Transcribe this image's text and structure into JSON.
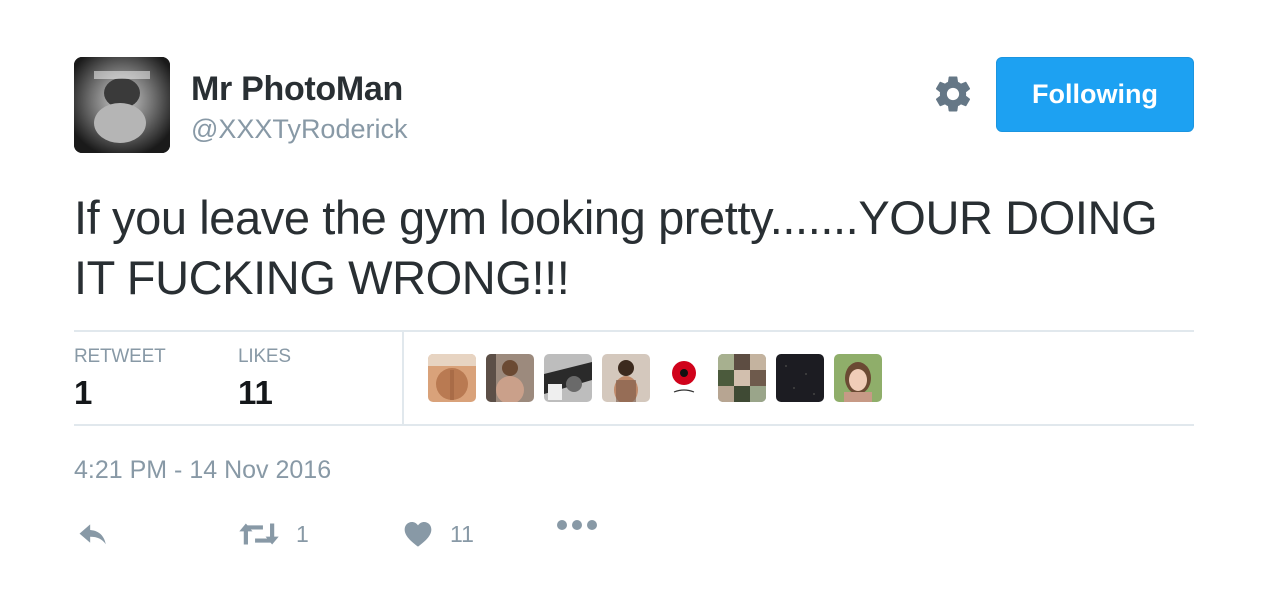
{
  "user": {
    "name": "Mr PhotoMan",
    "handle": "@XXXTyRoderick",
    "follow_button": "Following",
    "settings_icon": "gear-icon"
  },
  "tweet": {
    "text": "If you leave the gym looking pretty.......YOUR DOING IT FUCKING WRONG!!!",
    "timestamp": "4:21 PM - 14 Nov 2016"
  },
  "stats": {
    "retweets_label": "RETWEET",
    "retweets_value": "1",
    "likes_label": "LIKES",
    "likes_value": "11"
  },
  "likers_count_shown": 8,
  "actions": {
    "reply_icon": "reply-icon",
    "retweet_icon": "retweet-icon",
    "retweet_count": "1",
    "like_icon": "heart-icon",
    "like_count": "11",
    "more_icon": "more-dots-icon"
  },
  "colors": {
    "accent": "#1da1f2",
    "text_primary": "#292f33",
    "text_secondary": "#8899a6",
    "divider": "#e1e8ed",
    "icon": "#8899a6"
  }
}
